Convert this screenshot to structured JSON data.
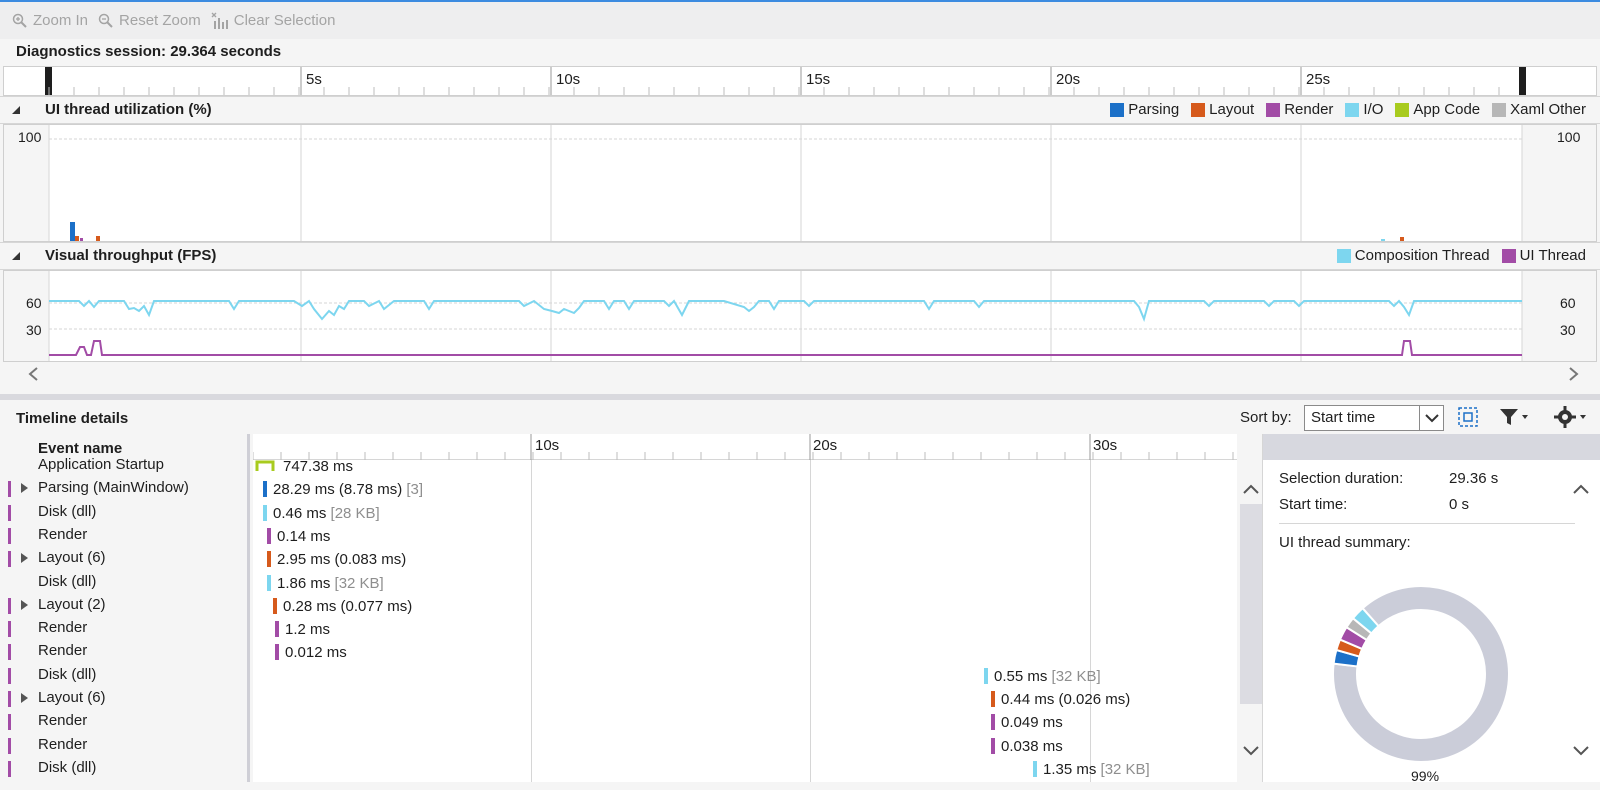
{
  "toolbar": {
    "zoom_in": "Zoom In",
    "reset_zoom": "Reset Zoom",
    "clear_selection": "Clear Selection"
  },
  "session": {
    "label": "Diagnostics session: 29.364 seconds"
  },
  "ruler": {
    "ticks": [
      "5s",
      "10s",
      "15s",
      "20s",
      "25s"
    ]
  },
  "ui_thread": {
    "title": "UI thread utilization (%)",
    "y_label_left": "100",
    "y_label_right": "100",
    "legend": [
      {
        "name": "Parsing",
        "color": "#1c70c8"
      },
      {
        "name": "Layout",
        "color": "#d65a1c"
      },
      {
        "name": "Render",
        "color": "#a24ca6"
      },
      {
        "name": "I/O",
        "color": "#7dd6ef"
      },
      {
        "name": "App Code",
        "color": "#a8cb1e"
      },
      {
        "name": "Xaml Other",
        "color": "#b7b7b7"
      }
    ]
  },
  "visual_throughput": {
    "title": "Visual throughput (FPS)",
    "y_labels_left": [
      "60",
      "30"
    ],
    "y_labels_right": [
      "60",
      "30"
    ],
    "legend": [
      {
        "name": "Composition Thread",
        "color": "#7dd6ef"
      },
      {
        "name": "UI Thread",
        "color": "#a24ca6"
      }
    ]
  },
  "details": {
    "title": "Timeline details",
    "sort_label": "Sort by:",
    "sort_value": "Start time",
    "column_header": "Event name",
    "ruler_ticks": [
      "10s",
      "20s",
      "30s"
    ],
    "events": [
      {
        "name": "Application Startup",
        "value": "747.38 ms",
        "extra": "",
        "color": "#a8cb1e",
        "category": "",
        "expandable": false
      },
      {
        "name": "Parsing (MainWindow)",
        "value": "28.29 ms (8.78 ms)",
        "extra": "[3]",
        "color": "#1c70c8",
        "category": "#a24ca6",
        "expandable": true
      },
      {
        "name": "Disk (dll)",
        "value": "0.46 ms",
        "extra": "[28 KB]",
        "color": "#7dd6ef",
        "category": "#a24ca6",
        "expandable": false
      },
      {
        "name": "Render",
        "value": "0.14 ms",
        "extra": "",
        "color": "#a24ca6",
        "category": "#a24ca6",
        "expandable": false
      },
      {
        "name": "Layout (6)",
        "value": "2.95 ms (0.083 ms)",
        "extra": "",
        "color": "#d65a1c",
        "category": "#a24ca6",
        "expandable": true
      },
      {
        "name": "Disk (dll)",
        "value": "1.86 ms",
        "extra": "[32 KB]",
        "color": "#7dd6ef",
        "category": "",
        "expandable": false
      },
      {
        "name": "Layout (2)",
        "value": "0.28 ms (0.077 ms)",
        "extra": "",
        "color": "#d65a1c",
        "category": "#a24ca6",
        "expandable": true
      },
      {
        "name": "Render",
        "value": "1.2 ms",
        "extra": "",
        "color": "#a24ca6",
        "category": "#a24ca6",
        "expandable": false
      },
      {
        "name": "Render",
        "value": "0.012 ms",
        "extra": "",
        "color": "#a24ca6",
        "category": "#a24ca6",
        "expandable": false
      },
      {
        "name": "Disk (dll)",
        "value": "0.55 ms",
        "extra": "[32 KB]",
        "color": "#7dd6ef",
        "category": "#a24ca6",
        "expandable": false
      },
      {
        "name": "Layout (6)",
        "value": "0.44 ms (0.026 ms)",
        "extra": "",
        "color": "#d65a1c",
        "category": "#a24ca6",
        "expandable": true
      },
      {
        "name": "Render",
        "value": "0.049 ms",
        "extra": "",
        "color": "#a24ca6",
        "category": "#a24ca6",
        "expandable": false
      },
      {
        "name": "Render",
        "value": "0.038 ms",
        "extra": "",
        "color": "#a24ca6",
        "category": "#a24ca6",
        "expandable": false
      },
      {
        "name": "Disk (dll)",
        "value": "1.35 ms",
        "extra": "[32 KB]",
        "color": "#7dd6ef",
        "category": "#a24ca6",
        "expandable": false
      }
    ]
  },
  "summary": {
    "selection_duration_label": "Selection duration:",
    "selection_duration_value": "29.36 s",
    "start_time_label": "Start time:",
    "start_time_value": "0 s",
    "ui_summary_label": "UI thread summary:",
    "percent_label": "99%"
  },
  "chart_data": {
    "type": "pie",
    "title": "",
    "categories": [
      "Xaml Other (remainder)",
      "Parsing",
      "Layout",
      "Render",
      "Xaml Other",
      "I/O"
    ],
    "values": [
      88,
      2.5,
      2,
      2.5,
      2,
      2.5
    ],
    "colors": [
      "#cbcdd9",
      "#1c70c8",
      "#d65a1c",
      "#a24ca6",
      "#b7b7b7",
      "#7dd6ef"
    ]
  }
}
